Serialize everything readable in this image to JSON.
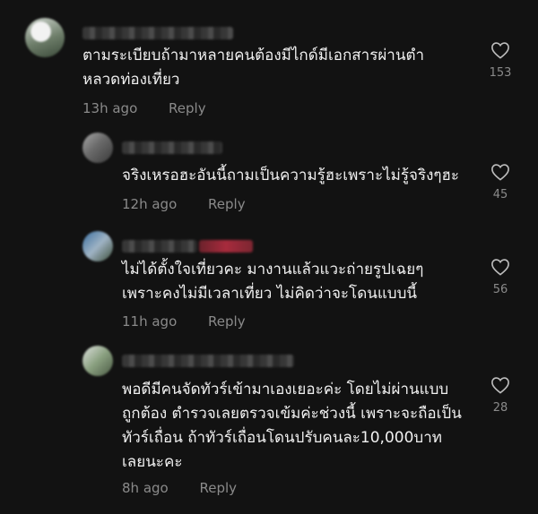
{
  "comments": [
    {
      "text": "ตามระเบียบถ้ามาหลายคนต้องมีไกด์มีเอกสารผ่านตำ\nหลวดท่องเที่ยว",
      "time": "13h ago",
      "reply": "Reply",
      "likes": "153"
    },
    {
      "text": "จริงเหรอฮะอันนี้ถามเป็นความรู้ฮะเพราะไม่รู้จริงๆฮะ",
      "time": "12h ago",
      "reply": "Reply",
      "likes": "45"
    },
    {
      "text": "ไม่ได้ตั้งใจเที่ยวคะ มางานแล้วแวะถ่ายรูปเฉยๆ\nเพราะคงไม่มีเวลาเที่ยว ไม่คิดว่าจะโดนแบบนี้",
      "time": "11h ago",
      "reply": "Reply",
      "likes": "56"
    },
    {
      "text": "พอดีมีคนจัดทัวร์เข้ามาเองเยอะค่ะ โดยไม่ผ่านแบบ\nถูกต้อง ตำรวจเลยตรวจเข้มค่ะช่วงนี้ เพราะจะถือเป็น\nทัวร์เถื่อน ถ้าทัวร์เถื่อนโดนปรับคนละ10,000บาท\nเลยนะคะ",
      "time": "8h ago",
      "reply": "Reply",
      "likes": "28"
    }
  ],
  "icons": {
    "like": "heart-outline-icon"
  },
  "colors": {
    "background": "#121212",
    "text": "#f0f0f0",
    "muted": "#8a8a8a"
  }
}
